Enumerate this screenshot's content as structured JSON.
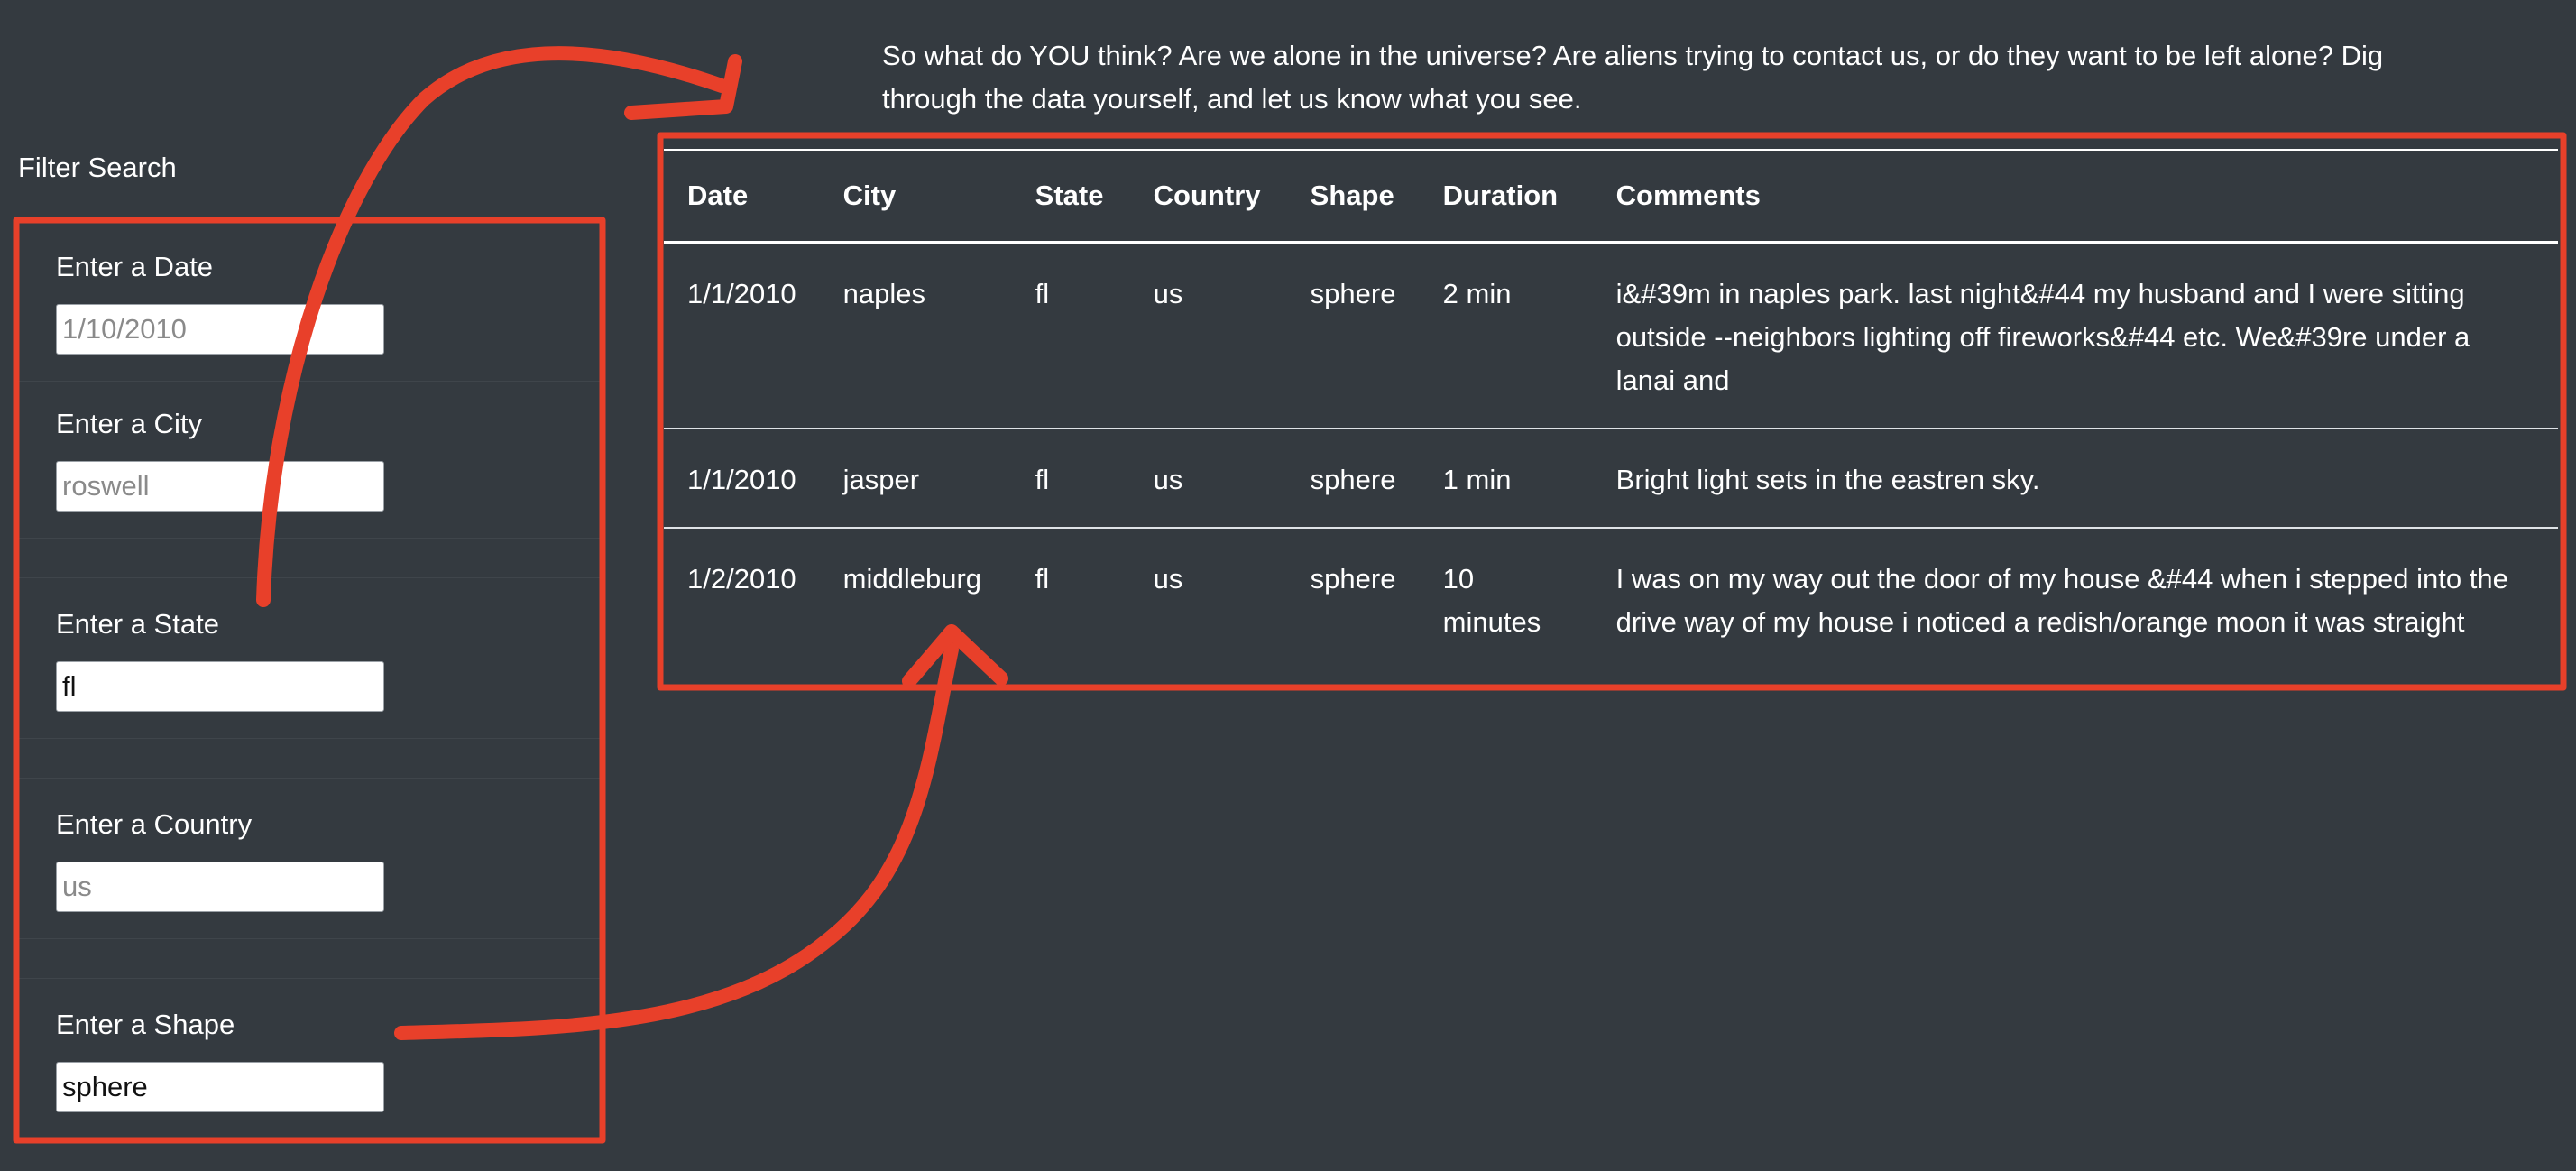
{
  "intro_text": "So what do YOU think? Are we alone in the universe? Are aliens trying to contact us, or do they want to be left alone? Dig through the data yourself, and let us know what you see.",
  "filter": {
    "title": "Filter Search",
    "date": {
      "label": "Enter a Date",
      "value": "",
      "placeholder": "1/10/2010"
    },
    "city": {
      "label": "Enter a City",
      "value": "",
      "placeholder": "roswell"
    },
    "state": {
      "label": "Enter a State",
      "value": "fl",
      "placeholder": ""
    },
    "country": {
      "label": "Enter a Country",
      "value": "",
      "placeholder": "us"
    },
    "shape": {
      "label": "Enter a Shape",
      "value": "sphere",
      "placeholder": ""
    }
  },
  "table": {
    "headers": [
      "Date",
      "City",
      "State",
      "Country",
      "Shape",
      "Duration",
      "Comments"
    ],
    "rows": [
      [
        "1/1/2010",
        "naples",
        "fl",
        "us",
        "sphere",
        "2 min",
        "i&#39m in naples park. last night&#44 my husband and I were sitting outside --neighbors lighting off fireworks&#44 etc. We&#39re under a lanai and"
      ],
      [
        "1/1/2010",
        "jasper",
        "fl",
        "us",
        "sphere",
        "1 min",
        "Bright light sets in the eastren sky."
      ],
      [
        "1/2/2010",
        "middleburg",
        "fl",
        "us",
        "sphere",
        "10 minutes",
        "I was on my way out the door of my house &#44 when i stepped into the drive way of my house i noticed a redish/orange moon it was straight"
      ]
    ]
  },
  "colors": {
    "background": "#343a40",
    "annotation": "#e8402a"
  }
}
